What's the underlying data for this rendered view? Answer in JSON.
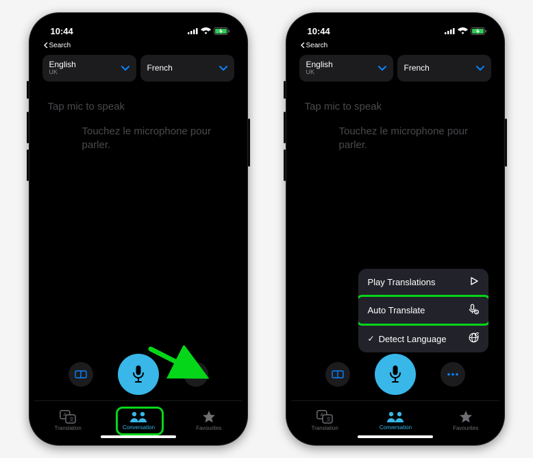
{
  "status": {
    "time": "10:44",
    "back": "Search"
  },
  "languages": {
    "source": {
      "name": "English",
      "sub": "UK"
    },
    "target": {
      "name": "French",
      "sub": ""
    }
  },
  "prompts": {
    "english": "Tap mic to speak",
    "french": "Touchez le microphone pour parler."
  },
  "tabs": {
    "translation": "Translation",
    "conversation": "Conversation",
    "favourites": "Favourites"
  },
  "menu": {
    "playTranslations": "Play Translations",
    "autoTranslate": "Auto Translate",
    "detectLanguage": "Detect Language"
  }
}
